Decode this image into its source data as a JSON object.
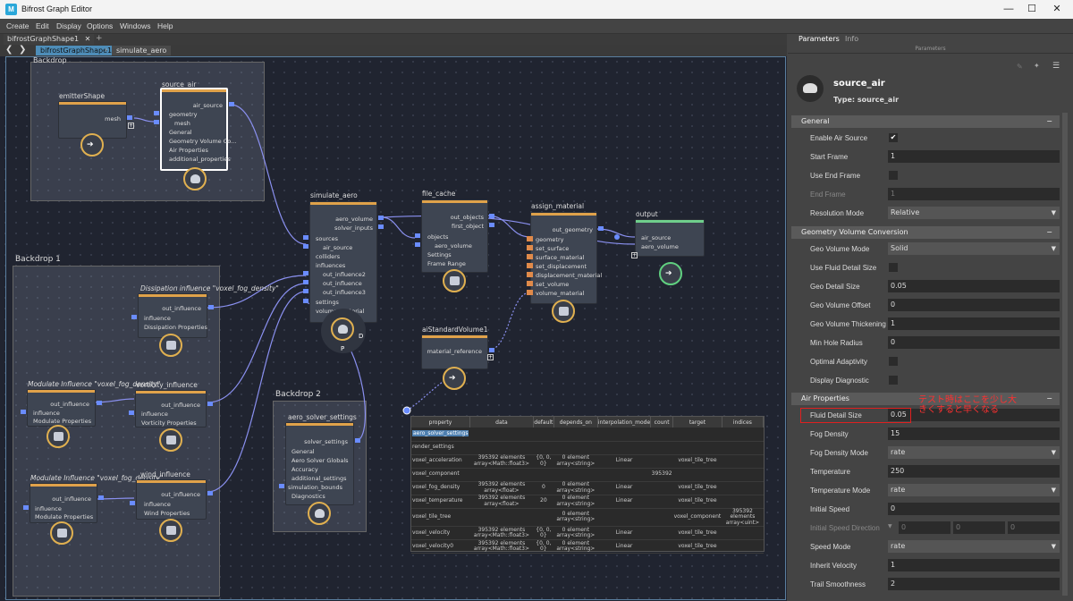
{
  "window": {
    "title": "Bifrost Graph Editor",
    "app_icon": "M",
    "minimize": "—",
    "maximize": "☐",
    "close": "✕"
  },
  "menu": [
    "Create",
    "Edit",
    "Display",
    "Options",
    "Windows",
    "Help"
  ],
  "doc_tab": {
    "label": "bifrostGraphShape1",
    "close": "✕",
    "add": "+"
  },
  "breadcrumb": {
    "back": "❮",
    "forward": "❯",
    "root": "bifrostGraphShape1",
    "sep": "›",
    "current": "simulate_aero"
  },
  "backdrops": {
    "top": "Backdrop",
    "b1": "Backdrop 1",
    "b2": "Backdrop 2"
  },
  "nodes": {
    "emitter": {
      "title": "emitterShape",
      "out": "mesh"
    },
    "source_air": {
      "title": "source_air",
      "ports": [
        "air_source",
        "geometry",
        "mesh",
        "General",
        "Geometry Volume Co...",
        "Air Properties",
        "additional_properties"
      ]
    },
    "simulate_aero": {
      "title": "simulate_aero",
      "outs": [
        "aero_volume",
        "solver_inputs"
      ],
      "ins": [
        "sources",
        "air_source",
        "colliders",
        "influences",
        "out_influence2",
        "out_influence",
        "out_influence3",
        "settings",
        "volume_material"
      ],
      "p": "P",
      "d": "D"
    },
    "file_cache": {
      "title": "file_cache",
      "outs": [
        "out_objects",
        "first_object"
      ],
      "ins": [
        "objects",
        "aero_volume",
        "Settings",
        "Frame Range"
      ]
    },
    "assign_material": {
      "title": "assign_material",
      "out": "out_geometry",
      "ins": [
        "geometry",
        "set_surface",
        "surface_material",
        "set_displacement",
        "displacement_material",
        "set_volume",
        "volume_material"
      ]
    },
    "output": {
      "title": "output",
      "ins": [
        "air_source",
        "aero_volume"
      ]
    },
    "dissipation": {
      "title": "Dissipation influence \"voxel_fog_density\"",
      "out": "out_influence",
      "ins": [
        "influence",
        "Dissipation Properties"
      ]
    },
    "modulate1": {
      "title": "Modulate Influence \"voxel_fog_density\"",
      "out": "out_influence",
      "ins": [
        "influence",
        "Modulate Properties"
      ]
    },
    "vorticity": {
      "title": "vorticity_influence",
      "out": "out_influence",
      "ins": [
        "influence",
        "Vorticity Properties"
      ]
    },
    "modulate2": {
      "title": "Modulate Influence \"voxel_fog_density\"",
      "out": "out_influence",
      "ins": [
        "influence",
        "Modulate Properties"
      ]
    },
    "wind": {
      "title": "wind_influence",
      "out": "out_influence",
      "ins": [
        "influence",
        "Wind Properties"
      ]
    },
    "ai_volume": {
      "title": "aiStandardVolume1",
      "out": "material_reference"
    },
    "aero_solver": {
      "title": "aero_solver_settings",
      "out": "solver_settings",
      "ins": [
        "General",
        "Aero Solver Globals",
        "Accuracy",
        "additional_settings",
        "simulation_bounds",
        "Diagnostics"
      ]
    }
  },
  "table": {
    "headers": [
      "property",
      "data",
      "default",
      "depends_on",
      "interpolation_mode",
      "count",
      "target",
      "indices"
    ],
    "rows": [
      {
        "property": "aero_solver_settings",
        "data": "",
        "default": "",
        "depends_on": "",
        "interp": "",
        "count": "",
        "target": "",
        "indices": ""
      },
      {
        "property": "render_settings",
        "data": "",
        "default": "",
        "depends_on": "",
        "interp": "",
        "count": "",
        "target": "",
        "indices": ""
      },
      {
        "property": "voxel_acceleration",
        "data": "395392 elements array<Math::float3>",
        "default": "{0, 0, 0}",
        "depends_on": "0 element array<string>",
        "interp": "Linear",
        "count": "",
        "target": "voxel_tile_tree",
        "indices": ""
      },
      {
        "property": "voxel_component",
        "data": "",
        "default": "",
        "depends_on": "",
        "interp": "",
        "count": "395392",
        "target": "",
        "indices": ""
      },
      {
        "property": "voxel_fog_density",
        "data": "395392 elements array<float>",
        "default": "0",
        "depends_on": "0 element array<string>",
        "interp": "Linear",
        "count": "",
        "target": "voxel_tile_tree",
        "indices": ""
      },
      {
        "property": "voxel_temperature",
        "data": "395392 elements array<float>",
        "default": "20",
        "depends_on": "0 element array<string>",
        "interp": "Linear",
        "count": "",
        "target": "voxel_tile_tree",
        "indices": ""
      },
      {
        "property": "voxel_tile_tree",
        "data": "",
        "default": "",
        "depends_on": "0 element array<string>",
        "interp": "",
        "count": "",
        "target": "voxel_component",
        "indices": "395392 elements array<uint>"
      },
      {
        "property": "voxel_velocity",
        "data": "395392 elements array<Math::float3>",
        "default": "{0, 0, 0}",
        "depends_on": "0 element array<string>",
        "interp": "Linear",
        "count": "",
        "target": "voxel_tile_tree",
        "indices": ""
      },
      {
        "property": "voxel_velocity0",
        "data": "395392 elements array<Math::float3>",
        "default": "{0, 0, 0}",
        "depends_on": "0 element array<string>",
        "interp": "Linear",
        "count": "",
        "target": "voxel_tile_tree",
        "indices": ""
      }
    ]
  },
  "panel": {
    "tabs": [
      "Parameters",
      "Info"
    ],
    "subheader": "Parameters",
    "node_name": "source_air",
    "node_type": "Type: source_air",
    "sections": {
      "general": "General",
      "geo": "Geometry Volume Conversion",
      "air": "Air Properties"
    },
    "collapse": "−",
    "general": [
      {
        "label": "Enable Air Source",
        "kind": "check",
        "value": "✔"
      },
      {
        "label": "Start Frame",
        "kind": "field",
        "value": "1"
      },
      {
        "label": "Use End Frame",
        "kind": "check",
        "value": ""
      },
      {
        "label": "End Frame",
        "kind": "field",
        "value": "1",
        "dim": true
      },
      {
        "label": "Resolution Mode",
        "kind": "dropdown",
        "value": "Relative"
      }
    ],
    "geo": [
      {
        "label": "Geo Volume Mode",
        "kind": "dropdown",
        "value": "Solid"
      },
      {
        "label": "Use Fluid Detail Size",
        "kind": "check",
        "value": ""
      },
      {
        "label": "Geo Detail Size",
        "kind": "field",
        "value": "0.05"
      },
      {
        "label": "Geo Volume Offset",
        "kind": "field",
        "value": "0"
      },
      {
        "label": "Geo Volume Thickening",
        "kind": "field",
        "value": "1"
      },
      {
        "label": "Min Hole Radius",
        "kind": "field",
        "value": "0"
      },
      {
        "label": "Optimal Adaptivity",
        "kind": "check",
        "value": ""
      },
      {
        "label": "Display Diagnostic",
        "kind": "check",
        "value": ""
      }
    ],
    "air": [
      {
        "label": "Fluid Detail Size",
        "kind": "field",
        "value": "0.05"
      },
      {
        "label": "Fog Density",
        "kind": "field",
        "value": "15"
      },
      {
        "label": "Fog Density Mode",
        "kind": "dropdown",
        "value": "rate"
      },
      {
        "label": "Temperature",
        "kind": "field",
        "value": "250"
      },
      {
        "label": "Temperature Mode",
        "kind": "dropdown",
        "value": "rate"
      },
      {
        "label": "Initial Speed",
        "kind": "field",
        "value": "0"
      },
      {
        "label": "Initial Speed Direction",
        "kind": "vec",
        "value": [
          "0",
          "0",
          "0"
        ],
        "dim": true
      },
      {
        "label": "Speed Mode",
        "kind": "dropdown",
        "value": "rate"
      },
      {
        "label": "Inherit Velocity",
        "kind": "field",
        "value": "1"
      },
      {
        "label": "Trail Smoothness",
        "kind": "field",
        "value": "2"
      }
    ],
    "annotation": "テスト時はここを少し大きくすると早くなる",
    "dropdown_arrow": "▼",
    "vec_arrow": "▼"
  }
}
